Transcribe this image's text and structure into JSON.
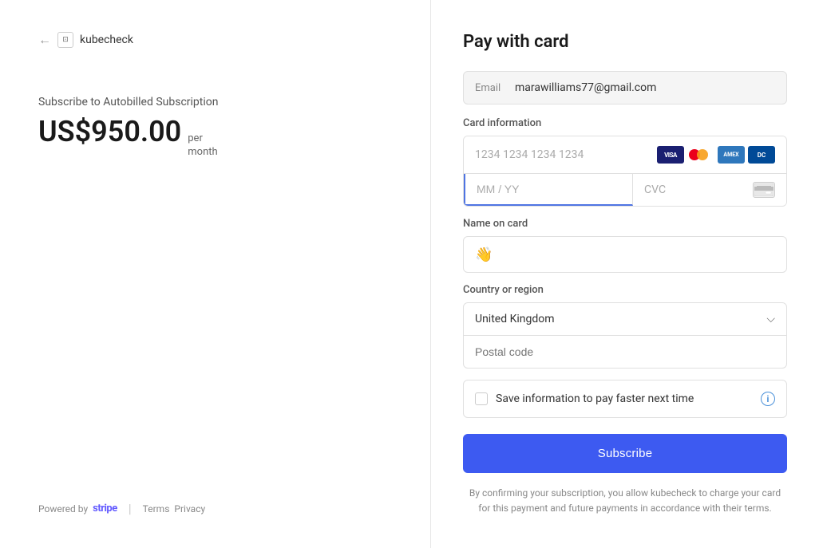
{
  "browser": {
    "back_label": "←",
    "icon_label": "⊡",
    "site_name": "kubecheck"
  },
  "left": {
    "subscription_label": "Subscribe to Autobilled Subscription",
    "price_amount": "US$950.00",
    "price_per": "per",
    "price_period": "month"
  },
  "footer": {
    "powered_by": "Powered by",
    "stripe": "stripe",
    "terms": "Terms",
    "privacy": "Privacy"
  },
  "right": {
    "title": "Pay with card",
    "email_label": "Email",
    "email_value": "marawilliams77@gmail.com",
    "card_info_label": "Card information",
    "card_number_placeholder": "1234 1234 1234 1234",
    "expiry_placeholder": "MM / YY",
    "cvc_placeholder": "CVC",
    "name_label": "Name on card",
    "country_label": "Country or region",
    "country_value": "United Kingdom",
    "postal_placeholder": "Postal code",
    "save_info_label": "Save information to pay faster next time",
    "subscribe_label": "Subscribe",
    "confirm_text": "By confirming your subscription, you allow kubecheck to charge your card for this payment and future payments in accordance with their terms.",
    "card_icons": {
      "visa": "VISA",
      "mastercard": "MC",
      "amex": "AMEX",
      "diners": "DC"
    }
  }
}
